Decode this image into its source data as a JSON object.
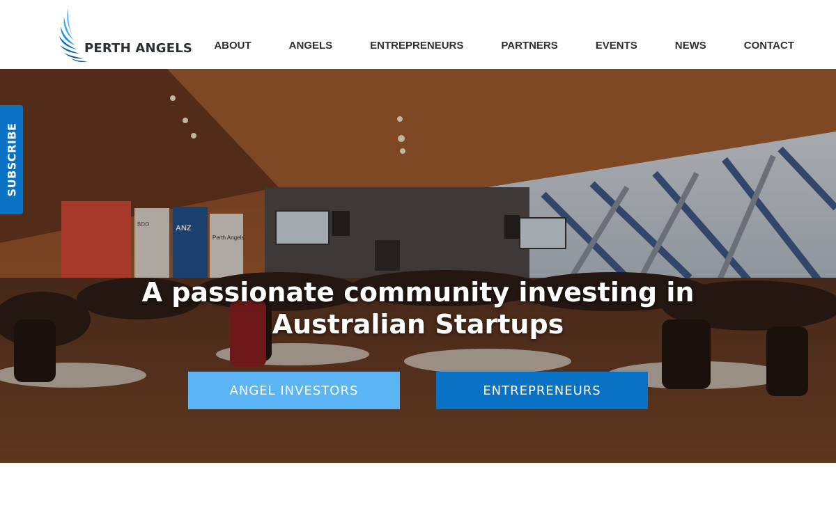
{
  "brand": {
    "name": "PERTH ANGELS",
    "logo_icon": "wing-icon",
    "accent": "#0a72c4",
    "light_accent": "#5bb5f5"
  },
  "nav": {
    "items": [
      {
        "label": "ABOUT"
      },
      {
        "label": "ANGELS"
      },
      {
        "label": "ENTREPRENEURS"
      },
      {
        "label": "PARTNERS"
      },
      {
        "label": "EVENTS"
      },
      {
        "label": "NEWS"
      },
      {
        "label": "CONTACT"
      }
    ]
  },
  "hero": {
    "headline": "A passionate community investing in Australian Startups",
    "buttons": {
      "investors": "ANGEL INVESTORS",
      "entrepreneurs": "ENTREPRENEURS"
    },
    "banners": {
      "anz": "ANZ",
      "perth_angels": "Perth Angels",
      "bdo": "BDO"
    }
  },
  "subscribe": {
    "label": "SUBSCRIBE"
  }
}
